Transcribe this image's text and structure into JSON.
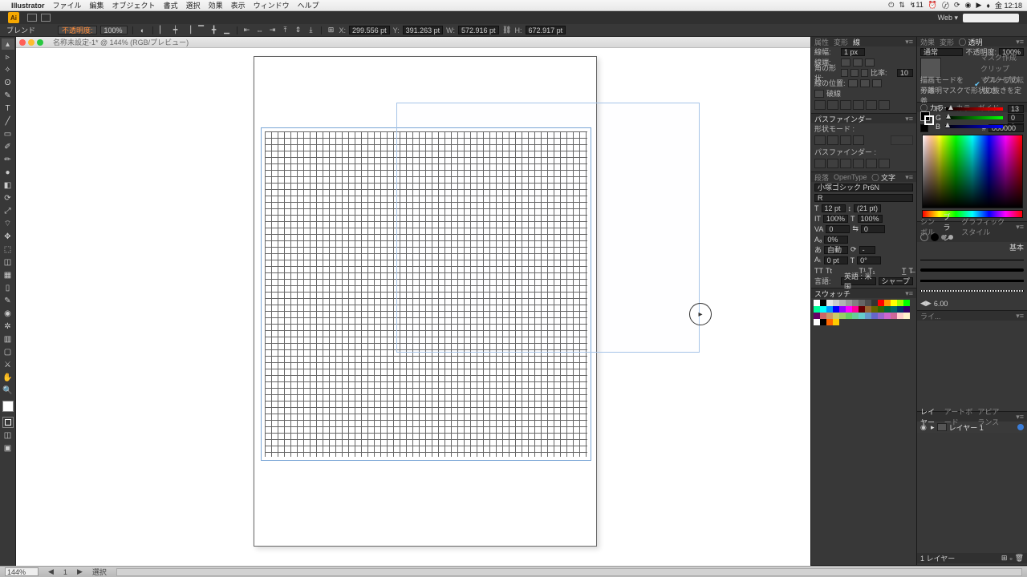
{
  "mac_menu": {
    "app": "Illustrator",
    "items": [
      "ファイル",
      "編集",
      "オブジェクト",
      "書式",
      "選択",
      "効果",
      "表示",
      "ウィンドウ",
      "ヘルプ"
    ],
    "status_right": [
      "⏻",
      "⇅",
      "↯11",
      "⏰",
      "〄",
      "⟳",
      "◉",
      "▶",
      "♦",
      "金 12:18"
    ]
  },
  "appbar": {
    "logo": "Ai",
    "mode": "Web",
    "mode_dd": "▾"
  },
  "ctrl": {
    "label": "ブレンド",
    "opacity_label": "不透明度:",
    "opacity_val": "100%",
    "coords": {
      "X": "299.556 pt",
      "Y": "391.263 pt",
      "W": "572.916 pt",
      "H": "672.917 pt"
    }
  },
  "document": {
    "tab_title": "名称未設定-1* @ 144% (RGB/プレビュー)"
  },
  "panels": {
    "stroke": {
      "tabs": [
        "属性",
        "変形",
        "線"
      ],
      "weight_label": "線幅:",
      "weight_val": "1 px",
      "cap_label": "線端:",
      "corner_label": "角の形状:",
      "ratio_label": "比率:",
      "ratio_val": "10",
      "align_label": "線の位置:",
      "dash_label": "破線"
    },
    "pathfinder": {
      "title": "パスファインダー",
      "mode_label": "形状モード :",
      "sub": "パスファインダー :"
    },
    "type": {
      "tabs": [
        "段落",
        "OpenType",
        "◯ 文字"
      ],
      "font": "小塚ゴシック Pr6N",
      "style": "R",
      "size": "12 pt",
      "leading": "(21 pt)",
      "hscale": "100%",
      "vscale": "100%",
      "va": "0",
      "tracking": "0",
      "baseline": "0%",
      "rotate": "自動",
      "shift": "0 pt",
      "skew": "0°",
      "lang_label": "言語:",
      "lang": "英語 : 米国",
      "aa_label": "",
      "aa": "シャープ"
    },
    "swatch": {
      "title": "スウォッチ"
    },
    "transparency": {
      "tabs": [
        "効果",
        "変形",
        "◯ 透明"
      ],
      "mode": "通常",
      "opacity_label": "不透明度:",
      "opacity": "100%",
      "mask_make": "マスク作成",
      "clip": "クリップ",
      "invert": "マスクを反転",
      "note1": "描画モードを分離",
      "note2": "グループの抜き",
      "note3": "不透明マスクで形状の抜きを定義"
    },
    "color": {
      "tabs": [
        "◯ カラー",
        "カラーガイド"
      ],
      "r": "13",
      "g": "0",
      "b": "0",
      "hex": "000000"
    },
    "brushes": {
      "tabs": [
        "シンボル",
        "ブラシ",
        "グラフィックスタイル"
      ],
      "basic": "基本",
      "size": "6.00"
    },
    "layers": {
      "tabs": [
        "レイヤー",
        "アートボード",
        "アピアランス"
      ],
      "layer_name": "レイヤー 1",
      "footer": "1 レイヤー"
    },
    "lib": {
      "label": "ライ..."
    }
  },
  "status": {
    "zoom": "144%",
    "tool": "選択"
  },
  "swatch_colors": [
    "#ffffff",
    "#000000",
    "#e6e6e6",
    "#cccccc",
    "#b3b3b3",
    "#999999",
    "#808080",
    "#666666",
    "#4d4d4d",
    "#333333",
    "#ff0000",
    "#ff9900",
    "#ffff00",
    "#99ff00",
    "#00ff00",
    "#00ff99",
    "#00ffff",
    "#0099ff",
    "#0000ff",
    "#9900ff",
    "#ff00ff",
    "#ff0099",
    "#660000",
    "#996633",
    "#666600",
    "#336600",
    "#006633",
    "#006666",
    "#003366",
    "#330066",
    "#660066",
    "#cc6666",
    "#cc9966",
    "#cccc66",
    "#99cc66",
    "#66cc66",
    "#66cc99",
    "#66cccc",
    "#6699cc",
    "#6666cc",
    "#9966cc",
    "#cc66cc",
    "#cc6699",
    "#ffcccc",
    "#fff2cc",
    "#ffffff",
    "#000000",
    "#ff6600",
    "#ffcc00"
  ]
}
